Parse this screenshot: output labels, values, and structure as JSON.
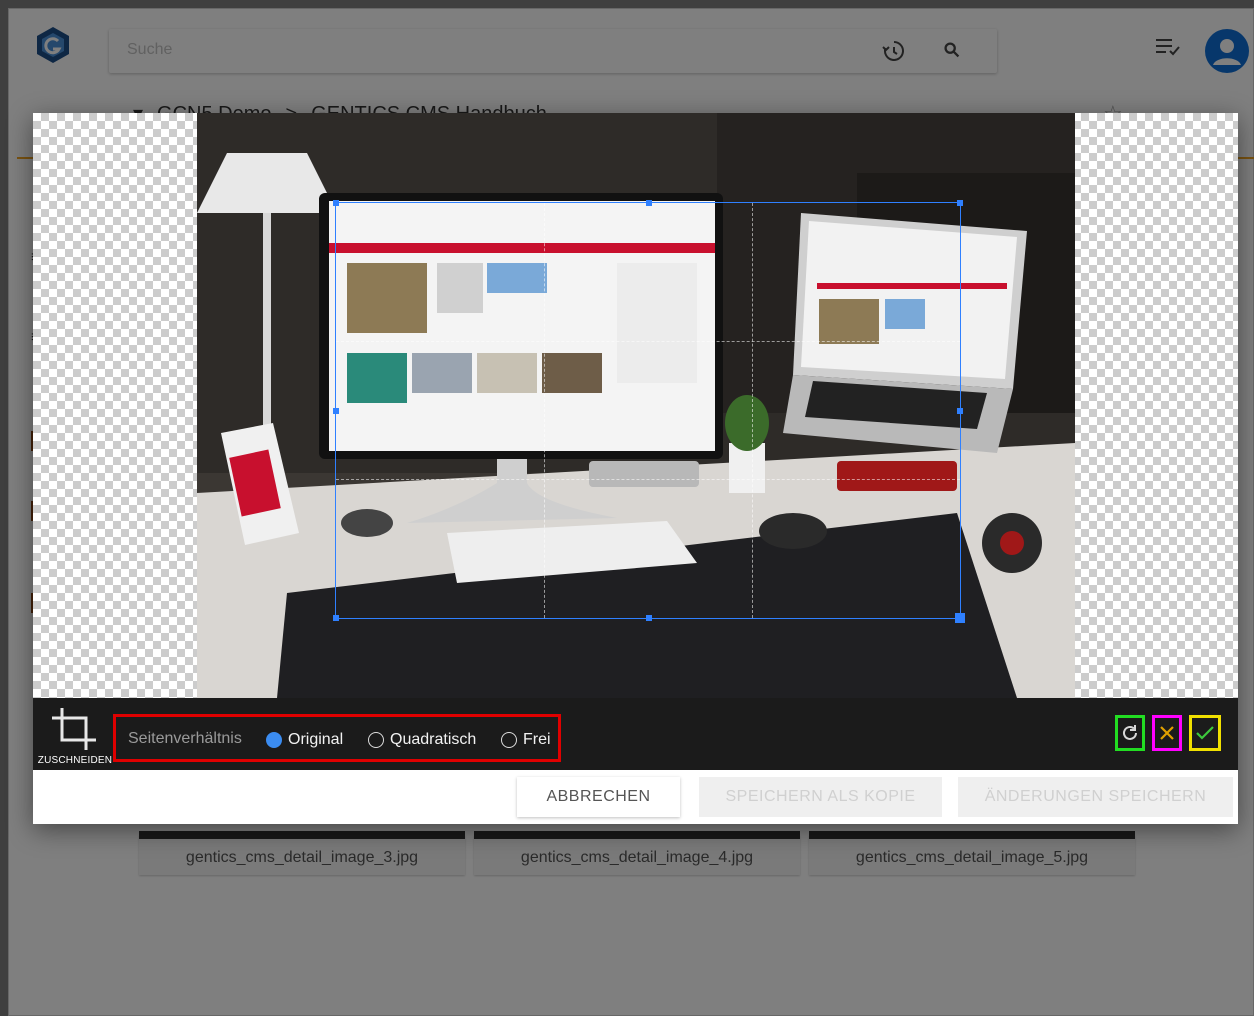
{
  "app": {
    "search_placeholder": "Suche",
    "breadcrumb": [
      "GCN5 Demo",
      ">",
      "GENTICS CMS Handbuch"
    ],
    "cards": [
      {
        "label": "gentics_cms_detail_image_3.jpg"
      },
      {
        "label": "gentics_cms_detail_image_4.jpg"
      },
      {
        "label": "gentics_cms_detail_image_5.jpg"
      }
    ]
  },
  "editor": {
    "tool_label": "ZUSCHNEIDEN",
    "ratio_label": "Seitenverhältnis",
    "ratio_options": [
      {
        "label": "Original",
        "selected": true
      },
      {
        "label": "Quadratisch",
        "selected": false
      },
      {
        "label": "Frei",
        "selected": false
      }
    ],
    "highlight_colors": {
      "ratio_group": "#e00000",
      "rotate": "#22dd22",
      "cancel": "#ff00ff",
      "apply": "#f0e000"
    }
  },
  "footer": {
    "cancel_label": "ABBRECHEN",
    "save_copy_label": "SPEICHERN ALS KOPIE",
    "save_changes_label": "ÄNDERUNGEN SPEICHERN"
  }
}
